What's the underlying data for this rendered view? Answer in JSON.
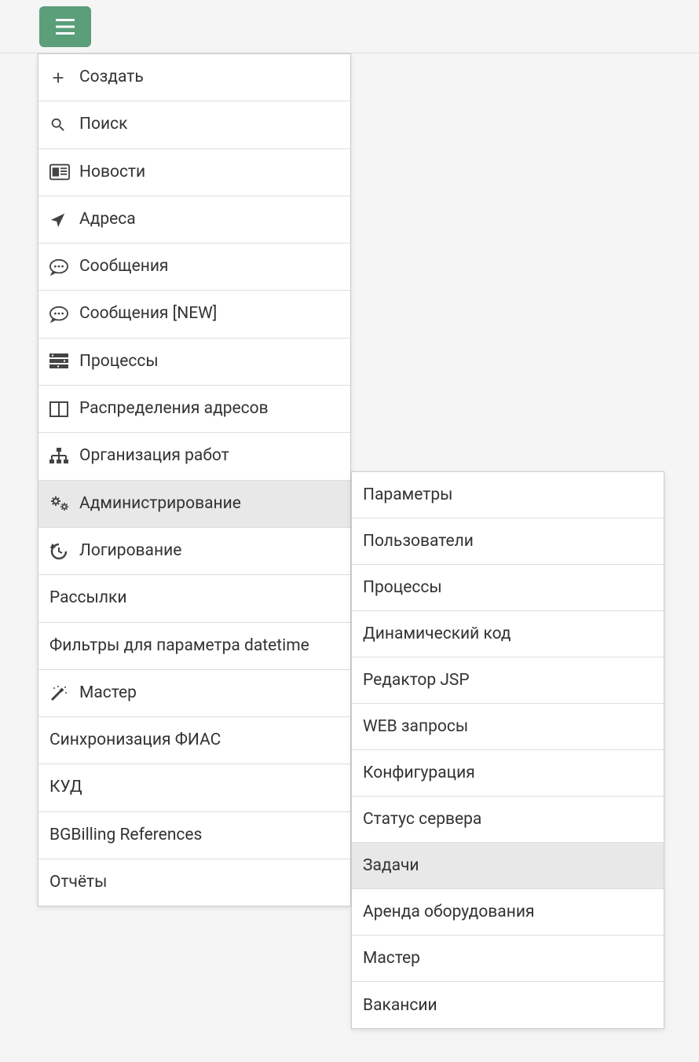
{
  "menu": {
    "items": [
      {
        "icon": "plus",
        "label": "Создать"
      },
      {
        "icon": "search",
        "label": "Поиск"
      },
      {
        "icon": "news",
        "label": "Новости"
      },
      {
        "icon": "location",
        "label": "Адреса"
      },
      {
        "icon": "chat",
        "label": "Сообщения"
      },
      {
        "icon": "chat",
        "label": "Сообщения [NEW]"
      },
      {
        "icon": "tasks",
        "label": "Процессы"
      },
      {
        "icon": "columns",
        "label": "Распределения адресов"
      },
      {
        "icon": "sitemap",
        "label": "Организация работ"
      },
      {
        "icon": "gears",
        "label": "Администрирование",
        "active": true
      },
      {
        "icon": "history",
        "label": "Логирование"
      },
      {
        "icon": "",
        "label": "Рассылки"
      },
      {
        "icon": "",
        "label": "Фильтры для параметра datetime"
      },
      {
        "icon": "magic",
        "label": "Мастер"
      },
      {
        "icon": "",
        "label": "Синхронизация ФИАС"
      },
      {
        "icon": "",
        "label": "КУД"
      },
      {
        "icon": "",
        "label": "BGBilling References"
      },
      {
        "icon": "",
        "label": "Отчёты"
      }
    ]
  },
  "submenu": {
    "items": [
      {
        "label": "Параметры"
      },
      {
        "label": "Пользователи"
      },
      {
        "label": "Процессы"
      },
      {
        "label": "Динамический код"
      },
      {
        "label": "Редактор JSP"
      },
      {
        "label": "WEB запросы"
      },
      {
        "label": "Конфигурация"
      },
      {
        "label": "Статус сервера"
      },
      {
        "label": "Задачи",
        "hovered": true
      },
      {
        "label": "Аренда оборудования"
      },
      {
        "label": "Мастер"
      },
      {
        "label": "Вакансии"
      }
    ]
  }
}
